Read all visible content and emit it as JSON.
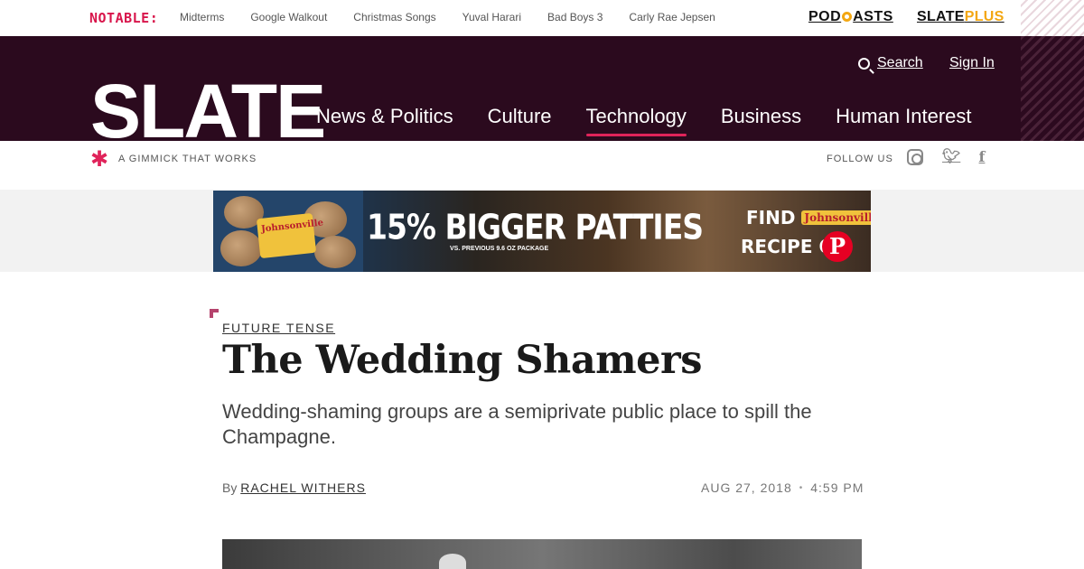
{
  "topbar": {
    "notable_label": "NOTABLE:",
    "trending": [
      "Midterms",
      "Google Walkout",
      "Christmas Songs",
      "Yuval Harari",
      "Bad Boys 3",
      "Carly Rae Jepsen"
    ],
    "podcasts_pre": "POD",
    "podcasts_post": "ASTS",
    "slateplus_a": "SLATE",
    "slateplus_b": "PLUS"
  },
  "header": {
    "logo": "SLATE",
    "search_label": "Search",
    "signin_label": "Sign In",
    "nav": [
      {
        "label": "News & Politics",
        "active": false
      },
      {
        "label": "Culture",
        "active": false
      },
      {
        "label": "Technology",
        "active": true
      },
      {
        "label": "Business",
        "active": false
      },
      {
        "label": "Human Interest",
        "active": false
      }
    ],
    "tagline": "A GIMMICK THAT WORKS",
    "follow_label": "FOLLOW US",
    "social_icons": [
      "instagram-icon",
      "twitter-icon",
      "facebook-icon"
    ]
  },
  "ad": {
    "brand": "Johnsonville",
    "headline": "15% BIGGER PATTIES",
    "subtext": "VS. PREVIOUS 9.6 OZ PACKAGE",
    "find_label": "FIND",
    "find_brand": "Johnsonville",
    "recipe_label": "RECIPE ON",
    "pin_glyph": "P"
  },
  "article": {
    "kicker": "FUTURE TENSE",
    "headline": "The Wedding Shamers",
    "dek": "Wedding-shaming groups are a semiprivate public place to spill the Champagne.",
    "by_label": "By",
    "author": "RACHEL WITHERS",
    "date": "AUG 27, 2018",
    "separator": "•",
    "time": "4:59 PM"
  },
  "colors": {
    "header_bg": "#2b0a1e",
    "accent": "#e0235a",
    "notable": "#d8154b",
    "gold": "#f3a712"
  }
}
